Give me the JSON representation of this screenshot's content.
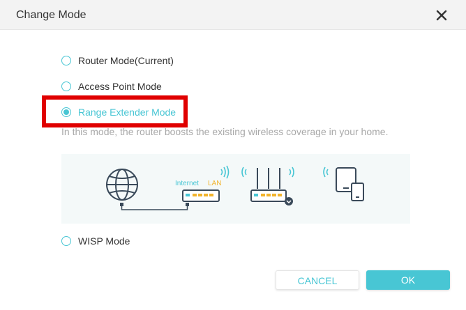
{
  "dialog": {
    "title": "Change Mode"
  },
  "modes": [
    {
      "label": "Router Mode(Current)",
      "checked": false
    },
    {
      "label": "Access Point Mode",
      "checked": false
    },
    {
      "label": "Range Extender Mode",
      "checked": true
    },
    {
      "label": "WISP Mode",
      "checked": false
    }
  ],
  "description": "In this mode, the router boosts the existing wireless coverage in your home.",
  "diagram": {
    "internet_label": "Internet",
    "lan_label": "LAN"
  },
  "buttons": {
    "cancel": "CANCEL",
    "ok": "OK"
  },
  "colors": {
    "accent": "#48c6d4",
    "lan_yellow": "#f2b42c",
    "icon_dark": "#3a4a5a",
    "highlight_red": "#e00000"
  }
}
